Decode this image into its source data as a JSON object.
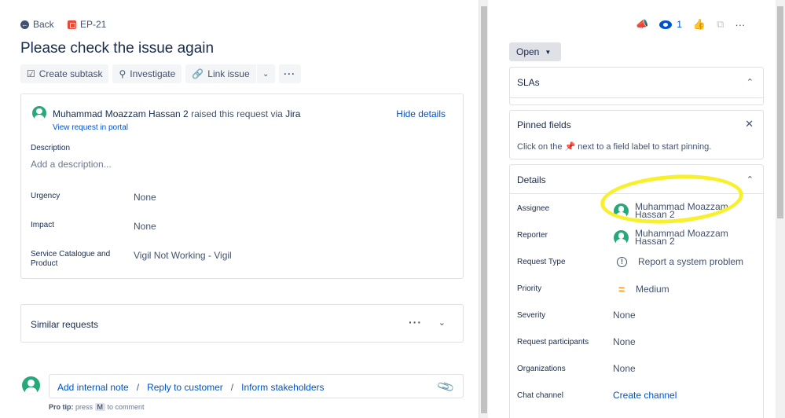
{
  "header": {
    "back_label": "Back",
    "issue_key": "EP-21",
    "title": "Please check the issue again"
  },
  "toolbar": {
    "create_subtask": "Create subtask",
    "investigate": "Investigate",
    "link_issue": "Link issue"
  },
  "request": {
    "reporter_name": "Muhammad Moazzam Hassan 2",
    "raised_text": " raised this request via ",
    "channel": "Jira",
    "view_portal": "View request in portal",
    "hide_details": "Hide details",
    "description_label": "Description",
    "description_placeholder": "Add a description...",
    "fields": [
      {
        "label": "Urgency",
        "value": "None"
      },
      {
        "label": "Impact",
        "value": "None"
      },
      {
        "label": "Service Catalogue and Product",
        "value": "Vigil Not Working - Vigil"
      }
    ]
  },
  "similar": {
    "title": "Similar requests"
  },
  "comment": {
    "add_internal_note": "Add internal note",
    "reply_to_customer": "Reply to customer",
    "inform_stakeholders": "Inform stakeholders",
    "protip_prefix": "Pro tip:",
    "protip_press": " press ",
    "protip_key": "M",
    "protip_suffix": " to comment"
  },
  "sidebar": {
    "watchers_count": "1",
    "status": "Open",
    "slas_title": "SLAs",
    "pinned_title": "Pinned fields",
    "pinned_hint_before": "Click on the ",
    "pinned_hint_after": " next to a field label to start pinning.",
    "details_title": "Details",
    "details": {
      "assignee_label": "Assignee",
      "assignee_line1": "Muhammad Moazzam",
      "assignee_line2": "Hassan 2",
      "reporter_label": "Reporter",
      "reporter_line1": "Muhammad Moazzam",
      "reporter_line2": "Hassan 2",
      "request_type_label": "Request Type",
      "request_type_value": "Report a system problem",
      "priority_label": "Priority",
      "priority_value": "Medium",
      "severity_label": "Severity",
      "severity_value": "None",
      "participants_label": "Request participants",
      "participants_value": "None",
      "organizations_label": "Organizations",
      "organizations_value": "None",
      "chat_label": "Chat channel",
      "chat_value": "Create channel"
    }
  },
  "colors": {
    "link": "#0052cc",
    "avatar": "#26a87a",
    "highlight": "#f8f02a",
    "priority_medium": "#ff991f",
    "issue_type": "#e5493a"
  },
  "icons": [
    "back-arrow-icon",
    "story-icon",
    "subtask-icon",
    "search-icon",
    "link-icon",
    "chevron-down-icon",
    "more-icon",
    "feedback-megaphone-icon",
    "eye-icon",
    "thumbs-up-icon",
    "share-icon",
    "close-icon",
    "pin-icon",
    "chevron-up-icon",
    "attachment-icon",
    "exclamation-icon",
    "priority-medium-icon"
  ]
}
